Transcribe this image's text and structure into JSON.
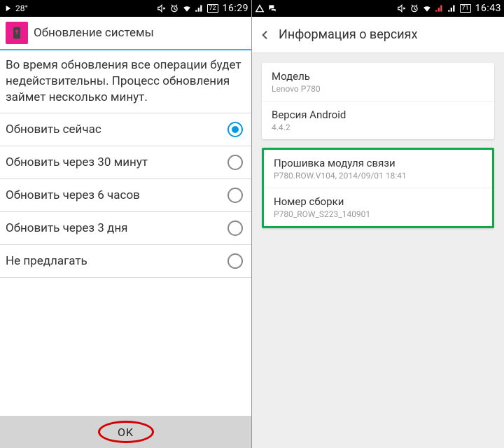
{
  "left": {
    "statusbar": {
      "temp": "28°",
      "battery": "72",
      "time": "16:29"
    },
    "title": "Обновление системы",
    "intro": "Во время обновления все операции будет недействительны. Процесс обновления займет несколько минут.",
    "options": [
      {
        "label": "Обновить сейчас",
        "checked": true
      },
      {
        "label": "Обновить через 30 минут",
        "checked": false
      },
      {
        "label": "Обновить через 6 часов",
        "checked": false
      },
      {
        "label": "Обновить через 3 дня",
        "checked": false
      },
      {
        "label": "Не предлагать",
        "checked": false
      }
    ],
    "ok": "OK"
  },
  "right": {
    "statusbar": {
      "battery": "71",
      "time": "16:43"
    },
    "title": "Информация о версиях",
    "card1": [
      {
        "title": "Модель",
        "sub": "Lenovo P780"
      },
      {
        "title": "Версия Android",
        "sub": "4.4.2"
      }
    ],
    "card2": [
      {
        "title": "Прошивка модуля связи",
        "sub": "P780.ROW.V104, 2014/09/01 18:41"
      },
      {
        "title": "Номер сборки",
        "sub": "P780_ROW_S223_140901"
      }
    ]
  }
}
